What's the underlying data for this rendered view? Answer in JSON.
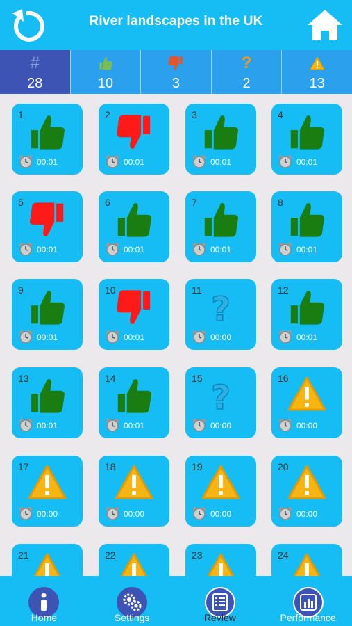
{
  "header": {
    "title": "River landscapes in the UK"
  },
  "stats": [
    {
      "icon": "hash-icon",
      "glyph": "#",
      "value": "28",
      "color": "#8a9bd6"
    },
    {
      "icon": "thumbs-up-icon",
      "value": "10",
      "color": "#7bbd4e"
    },
    {
      "icon": "thumbs-down-icon",
      "value": "3",
      "color": "#e8542a"
    },
    {
      "icon": "question-icon",
      "glyph": "?",
      "value": "2",
      "color": "#f59a1c"
    },
    {
      "icon": "warning-icon",
      "value": "13",
      "color": "#f7b514"
    }
  ],
  "tiles": [
    {
      "num": "1",
      "result": "correct",
      "time": "00:01"
    },
    {
      "num": "2",
      "result": "wrong",
      "time": "00:01"
    },
    {
      "num": "3",
      "result": "correct",
      "time": "00:01"
    },
    {
      "num": "4",
      "result": "correct",
      "time": "00:01"
    },
    {
      "num": "5",
      "result": "wrong",
      "time": "00:01"
    },
    {
      "num": "6",
      "result": "correct",
      "time": "00:01"
    },
    {
      "num": "7",
      "result": "correct",
      "time": "00:01"
    },
    {
      "num": "8",
      "result": "correct",
      "time": "00:01"
    },
    {
      "num": "9",
      "result": "correct",
      "time": "00:01"
    },
    {
      "num": "10",
      "result": "wrong",
      "time": "00:01"
    },
    {
      "num": "11",
      "result": "unsure",
      "time": "00:00"
    },
    {
      "num": "12",
      "result": "correct",
      "time": "00:01"
    },
    {
      "num": "13",
      "result": "correct",
      "time": "00:01"
    },
    {
      "num": "14",
      "result": "correct",
      "time": "00:01"
    },
    {
      "num": "15",
      "result": "unsure",
      "time": "00:00"
    },
    {
      "num": "16",
      "result": "unanswered",
      "time": "00:00"
    },
    {
      "num": "17",
      "result": "unanswered",
      "time": "00:00"
    },
    {
      "num": "18",
      "result": "unanswered",
      "time": "00:00"
    },
    {
      "num": "19",
      "result": "unanswered",
      "time": "00:00"
    },
    {
      "num": "20",
      "result": "unanswered",
      "time": "00:00"
    },
    {
      "num": "21",
      "result": "unanswered",
      "time": ""
    },
    {
      "num": "22",
      "result": "unanswered",
      "time": ""
    },
    {
      "num": "23",
      "result": "unanswered",
      "time": ""
    },
    {
      "num": "24",
      "result": "unanswered",
      "time": ""
    }
  ],
  "nav": [
    {
      "label": "Home",
      "icon": "info-icon"
    },
    {
      "label": "Settings",
      "icon": "gears-icon"
    },
    {
      "label": "Review",
      "icon": "list-icon",
      "active": true
    },
    {
      "label": "Performance",
      "icon": "bar-chart-icon"
    }
  ],
  "colors": {
    "primary": "#16bcf4",
    "accent": "#3d54b5",
    "correct": "#1a7d12",
    "wrong": "#ff1a1a",
    "warning": "#f7b514"
  }
}
